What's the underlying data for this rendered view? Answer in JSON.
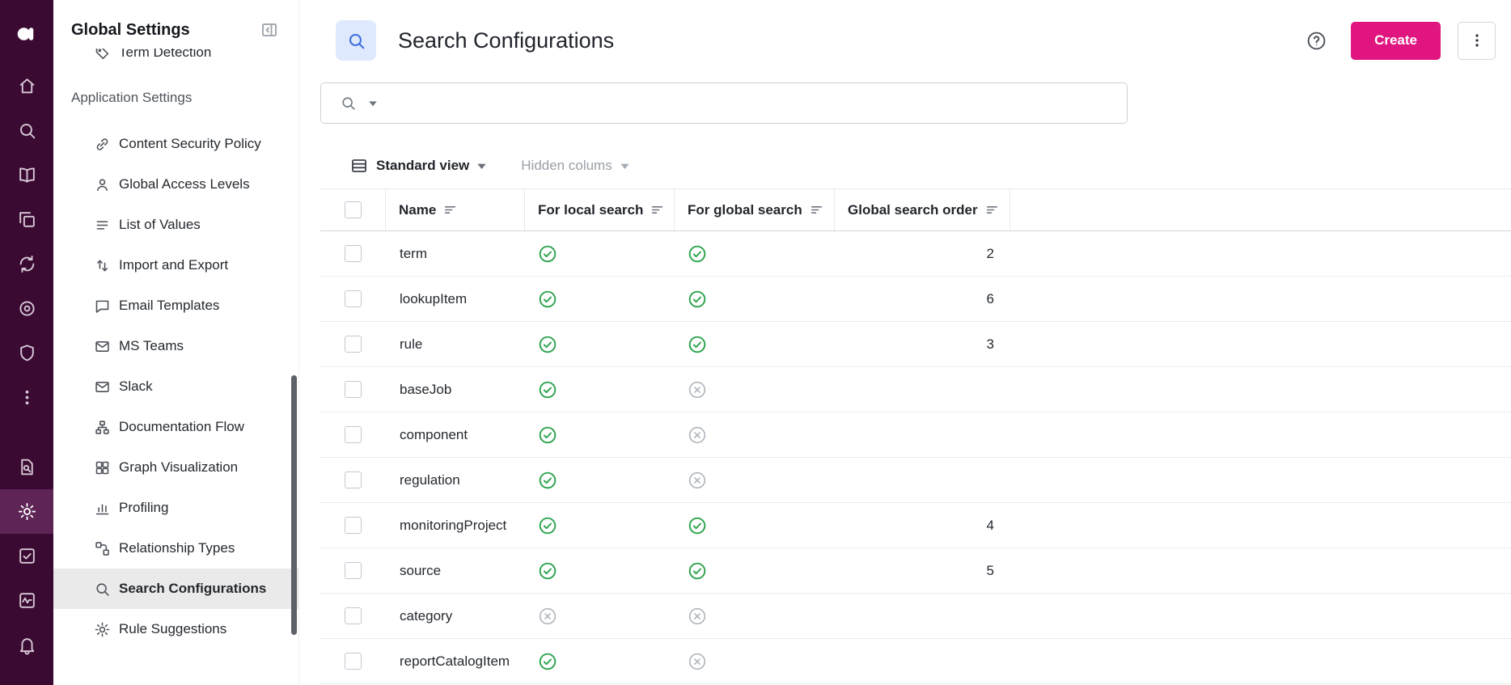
{
  "colors": {
    "rail_bg": "#3A0A33",
    "rail_active_bg": "#5D2455",
    "accent_pink": "#E0157F",
    "header_icon_bg": "#DFE9FD",
    "header_icon_fg": "#3D6EDF",
    "check_green": "#2EA44E",
    "cross_gray": "#AFB5BC",
    "selected_item_bg": "#EAEAEA"
  },
  "rail": {
    "logo_icon": "ataccama-logo",
    "top": [
      {
        "icon": "home"
      },
      {
        "icon": "search"
      },
      {
        "icon": "book"
      },
      {
        "icon": "copy"
      },
      {
        "icon": "sync"
      },
      {
        "icon": "target"
      },
      {
        "icon": "shield"
      },
      {
        "icon": "dots-vertical"
      }
    ],
    "bottom": [
      {
        "icon": "file-search"
      },
      {
        "icon": "gear",
        "active": true
      },
      {
        "icon": "task-check"
      },
      {
        "icon": "pulse"
      },
      {
        "icon": "bell"
      }
    ]
  },
  "sidebar": {
    "title": "Global Settings",
    "scrolled_item": {
      "label": "Term Detection",
      "icon": "tag"
    },
    "section_label": "Application Settings",
    "items": [
      {
        "label": "Content Security Policy",
        "icon": "link"
      },
      {
        "label": "Global Access Levels",
        "icon": "person"
      },
      {
        "label": "List of Values",
        "icon": "list"
      },
      {
        "label": "Import and Export",
        "icon": "import-export"
      },
      {
        "label": "Email Templates",
        "icon": "comment"
      },
      {
        "label": "MS Teams",
        "icon": "envelope"
      },
      {
        "label": "Slack",
        "icon": "envelope"
      },
      {
        "label": "Documentation Flow",
        "icon": "flow"
      },
      {
        "label": "Graph Visualization",
        "icon": "grid"
      },
      {
        "label": "Profiling",
        "icon": "bar-chart"
      },
      {
        "label": "Relationship Types",
        "icon": "relationship"
      },
      {
        "label": "Search Configurations",
        "icon": "search",
        "selected": true
      },
      {
        "label": "Rule Suggestions",
        "icon": "gear"
      }
    ]
  },
  "header": {
    "title": "Search Configurations",
    "create_label": "Create"
  },
  "search": {
    "value": ""
  },
  "toolbar": {
    "view_label": "Standard view",
    "hidden_columns_label": "Hidden colums"
  },
  "table": {
    "columns": [
      {
        "label": "Name"
      },
      {
        "label": "For local search"
      },
      {
        "label": "For global search"
      },
      {
        "label": "Global search order"
      }
    ],
    "rows": [
      {
        "name": "term",
        "local_search": true,
        "global_search": true,
        "order": "2"
      },
      {
        "name": "lookupItem",
        "local_search": true,
        "global_search": true,
        "order": "6"
      },
      {
        "name": "rule",
        "local_search": true,
        "global_search": true,
        "order": "3"
      },
      {
        "name": "baseJob",
        "local_search": true,
        "global_search": false,
        "order": ""
      },
      {
        "name": "component",
        "local_search": true,
        "global_search": false,
        "order": ""
      },
      {
        "name": "regulation",
        "local_search": true,
        "global_search": false,
        "order": ""
      },
      {
        "name": "monitoringProject",
        "local_search": true,
        "global_search": true,
        "order": "4"
      },
      {
        "name": "source",
        "local_search": true,
        "global_search": true,
        "order": "5"
      },
      {
        "name": "category",
        "local_search": false,
        "global_search": false,
        "order": ""
      },
      {
        "name": "reportCatalogItem",
        "local_search": true,
        "global_search": false,
        "order": ""
      }
    ]
  }
}
